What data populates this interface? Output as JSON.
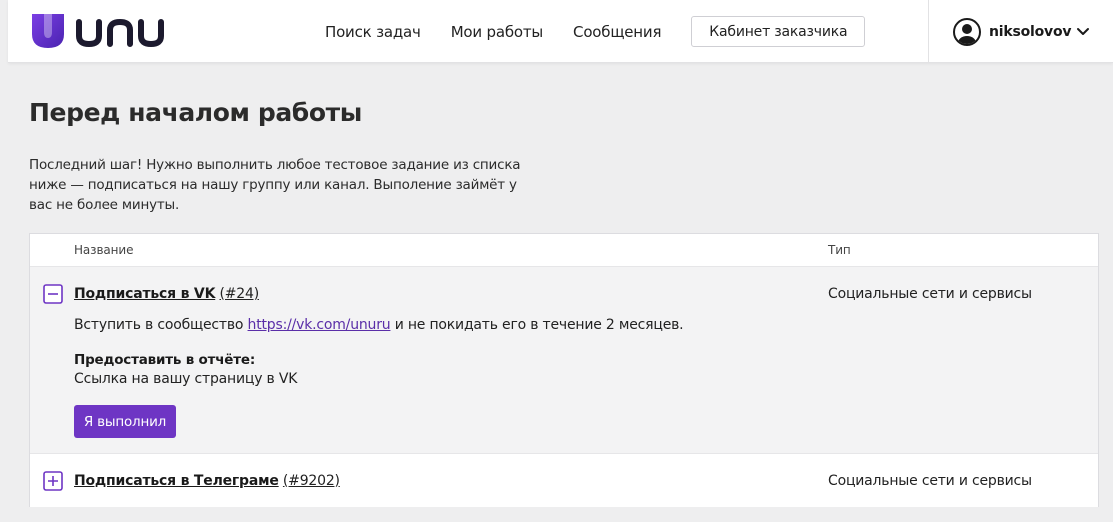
{
  "header": {
    "brand": "unu",
    "nav": [
      "Поиск задач",
      "Мои работы",
      "Сообщения"
    ],
    "cabinet_button": "Кабинет заказчика",
    "username": "niksolovov",
    "accent_color": "#6e35c4"
  },
  "page": {
    "title": "Перед началом работы",
    "intro": "Последний шаг! Нужно выполнить любое тестовое задание из списка ниже — подписаться на нашу группу или канал. Выполение займёт у вас не более минуты."
  },
  "table": {
    "columns": {
      "name": "Название",
      "type": "Тип"
    },
    "tasks": [
      {
        "title": "Подписаться в VK",
        "id": "(#24)",
        "type": "Социальные сети и сервисы",
        "expanded": true,
        "description_before": "Вступить в сообщество ",
        "description_link": "https://vk.com/unuru",
        "description_after": " и не покидать его в течение 2 месяцев.",
        "report_label": "Предоставить в отчёте:",
        "report_value": "Ссылка на вашу страницу в VK",
        "button": "Я выполнил"
      },
      {
        "title": "Подписаться в Телеграме",
        "id": "(#9202)",
        "type": "Социальные сети и сервисы",
        "expanded": false
      }
    ]
  }
}
